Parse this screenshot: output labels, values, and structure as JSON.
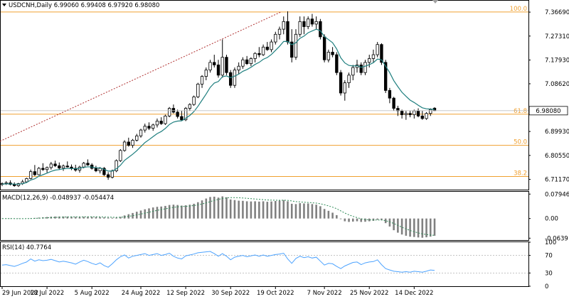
{
  "header": {
    "symbol_line": "USDCNH,Daily  6.99060 6.99408 6.97920 6.98080"
  },
  "colors": {
    "candle": "#000000",
    "ema": "#1f7f7f",
    "fib": "#f0a030",
    "trendline": "#b03030",
    "macd_hist": "#808080",
    "macd_signal": "#2e8b57",
    "rsi": "#4da3ff",
    "price_tag_bg": "#ffffff"
  },
  "chart_data": [
    {
      "type": "candlestick",
      "panel": "price",
      "title": "USDCNH,Daily",
      "ohlc_last": {
        "open": 6.9906,
        "high": 6.99408,
        "low": 6.9792,
        "close": 6.9808
      },
      "last_price_label": "6.98080",
      "ylim": [
        6.6715,
        7.4116
      ],
      "y_ticks": [
        "7.36690",
        "7.27310",
        "7.17930",
        "7.08620",
        "6.99930",
        "6.89930",
        "6.80550",
        "6.71170"
      ],
      "y_tick_values": [
        7.3669,
        7.2731,
        7.1793,
        7.0862,
        6.9993,
        6.8993,
        6.8055,
        6.7117
      ],
      "fib_levels": [
        {
          "label": "100.0",
          "value": 7.3675
        },
        {
          "label": "61.8",
          "value": 6.967
        },
        {
          "label": "50.0",
          "value": 6.845
        },
        {
          "label": "38.2",
          "value": 6.723
        }
      ],
      "trendline": {
        "from": {
          "date": "29 Jun 2022",
          "value": 6.861
        },
        "to": {
          "date": "19 Oct 2022",
          "value": 7.3675
        }
      },
      "x_ticks": [
        "29 Jun 2022",
        "18 Jul 2022",
        "5 Aug 2022",
        "24 Aug 2022",
        "12 Sep 2022",
        "30 Sep 2022",
        "19 Oct 2022",
        "7 Nov 2022",
        "25 Nov 2022",
        "14 Dec 2022"
      ],
      "candles": [
        [
          6.692,
          6.7,
          6.685,
          6.695
        ],
        [
          6.695,
          6.705,
          6.69,
          6.698
        ],
        [
          6.698,
          6.708,
          6.688,
          6.692
        ],
        [
          6.692,
          6.7,
          6.683,
          6.687
        ],
        [
          6.687,
          6.698,
          6.682,
          6.695
        ],
        [
          6.695,
          6.71,
          6.69,
          6.702
        ],
        [
          6.702,
          6.718,
          6.698,
          6.715
        ],
        [
          6.715,
          6.75,
          6.712,
          6.742
        ],
        [
          6.742,
          6.768,
          6.725,
          6.73
        ],
        [
          6.73,
          6.76,
          6.728,
          6.755
        ],
        [
          6.755,
          6.775,
          6.745,
          6.75
        ],
        [
          6.75,
          6.762,
          6.738,
          6.758
        ],
        [
          6.758,
          6.78,
          6.75,
          6.772
        ],
        [
          6.772,
          6.785,
          6.76,
          6.765
        ],
        [
          6.765,
          6.778,
          6.75,
          6.756
        ],
        [
          6.756,
          6.77,
          6.745,
          6.764
        ],
        [
          6.764,
          6.782,
          6.758,
          6.76
        ],
        [
          6.76,
          6.77,
          6.748,
          6.755
        ],
        [
          6.755,
          6.769,
          6.742,
          6.748
        ],
        [
          6.748,
          6.765,
          6.738,
          6.76
        ],
        [
          6.76,
          6.78,
          6.755,
          6.775
        ],
        [
          6.775,
          6.79,
          6.765,
          6.768
        ],
        [
          6.768,
          6.775,
          6.75,
          6.755
        ],
        [
          6.755,
          6.765,
          6.74,
          6.745
        ],
        [
          6.745,
          6.76,
          6.735,
          6.755
        ],
        [
          6.755,
          6.76,
          6.725,
          6.73
        ],
        [
          6.73,
          6.74,
          6.71,
          6.72
        ],
        [
          6.72,
          6.75,
          6.715,
          6.745
        ],
        [
          6.745,
          6.79,
          6.74,
          6.785
        ],
        [
          6.785,
          6.83,
          6.78,
          6.825
        ],
        [
          6.825,
          6.865,
          6.82,
          6.858
        ],
        [
          6.858,
          6.875,
          6.84,
          6.845
        ],
        [
          6.845,
          6.87,
          6.835,
          6.865
        ],
        [
          6.865,
          6.89,
          6.86,
          6.882
        ],
        [
          6.882,
          6.91,
          6.875,
          6.905
        ],
        [
          6.905,
          6.93,
          6.895,
          6.92
        ],
        [
          6.92,
          6.935,
          6.905,
          6.912
        ],
        [
          6.912,
          6.93,
          6.902,
          6.925
        ],
        [
          6.925,
          6.95,
          6.915,
          6.94
        ],
        [
          6.94,
          6.955,
          6.925,
          6.93
        ],
        [
          6.93,
          6.965,
          6.925,
          6.96
        ],
        [
          6.96,
          6.995,
          6.955,
          6.99
        ],
        [
          6.99,
          7.005,
          6.97,
          6.975
        ],
        [
          6.975,
          6.985,
          6.95,
          6.958
        ],
        [
          6.958,
          6.98,
          6.94,
          6.945
        ],
        [
          6.945,
          6.995,
          6.94,
          6.99
        ],
        [
          6.99,
          7.01,
          6.98,
          7.005
        ],
        [
          7.005,
          7.04,
          7.0,
          7.035
        ],
        [
          7.035,
          7.09,
          7.03,
          7.085
        ],
        [
          7.085,
          7.12,
          7.07,
          7.115
        ],
        [
          7.115,
          7.15,
          7.1,
          7.14
        ],
        [
          7.14,
          7.18,
          7.13,
          7.17
        ],
        [
          7.17,
          7.2,
          7.15,
          7.16
        ],
        [
          7.16,
          7.18,
          7.11,
          7.12
        ],
        [
          7.12,
          7.26,
          7.11,
          7.19
        ],
        [
          7.19,
          7.2,
          7.12,
          7.13
        ],
        [
          7.13,
          7.14,
          7.07,
          7.08
        ],
        [
          7.08,
          7.15,
          7.07,
          7.14
        ],
        [
          7.14,
          7.17,
          7.125,
          7.155
        ],
        [
          7.155,
          7.19,
          7.145,
          7.18
        ],
        [
          7.18,
          7.195,
          7.16,
          7.165
        ],
        [
          7.165,
          7.19,
          7.155,
          7.185
        ],
        [
          7.185,
          7.21,
          7.17,
          7.205
        ],
        [
          7.205,
          7.23,
          7.19,
          7.2
        ],
        [
          7.2,
          7.24,
          7.195,
          7.23
        ],
        [
          7.23,
          7.25,
          7.215,
          7.22
        ],
        [
          7.22,
          7.26,
          7.21,
          7.25
        ],
        [
          7.25,
          7.29,
          7.24,
          7.28
        ],
        [
          7.28,
          7.31,
          7.26,
          7.3
        ],
        [
          7.3,
          7.35,
          7.28,
          7.33
        ],
        [
          7.33,
          7.37,
          7.24,
          7.25
        ],
        [
          7.25,
          7.3,
          7.17,
          7.19
        ],
        [
          7.19,
          7.3,
          7.18,
          7.28
        ],
        [
          7.28,
          7.35,
          7.27,
          7.33
        ],
        [
          7.33,
          7.35,
          7.28,
          7.31
        ],
        [
          7.31,
          7.35,
          7.3,
          7.34
        ],
        [
          7.34,
          7.36,
          7.31,
          7.32
        ],
        [
          7.32,
          7.35,
          7.3,
          7.33
        ],
        [
          7.33,
          7.34,
          7.26,
          7.27
        ],
        [
          7.27,
          7.28,
          7.17,
          7.18
        ],
        [
          7.18,
          7.22,
          7.17,
          7.21
        ],
        [
          7.21,
          7.23,
          7.19,
          7.2
        ],
        [
          7.2,
          7.21,
          7.12,
          7.13
        ],
        [
          7.13,
          7.14,
          7.04,
          7.05
        ],
        [
          7.05,
          7.1,
          7.02,
          7.09
        ],
        [
          7.09,
          7.13,
          7.07,
          7.12
        ],
        [
          7.12,
          7.16,
          7.1,
          7.15
        ],
        [
          7.15,
          7.18,
          7.13,
          7.16
        ],
        [
          7.16,
          7.17,
          7.12,
          7.13
        ],
        [
          7.13,
          7.18,
          7.12,
          7.17
        ],
        [
          7.17,
          7.2,
          7.15,
          7.185
        ],
        [
          7.185,
          7.22,
          7.17,
          7.2
        ],
        [
          7.2,
          7.25,
          7.19,
          7.24
        ],
        [
          7.24,
          7.245,
          7.16,
          7.17
        ],
        [
          7.17,
          7.18,
          7.05,
          7.06
        ],
        [
          7.06,
          7.07,
          7.01,
          7.03
        ],
        [
          7.03,
          7.035,
          6.98,
          6.99
        ],
        [
          6.99,
          7.0,
          6.96,
          6.98
        ],
        [
          6.98,
          6.985,
          6.95,
          6.965
        ],
        [
          6.965,
          6.98,
          6.945,
          6.97
        ],
        [
          6.97,
          6.98,
          6.955,
          6.965
        ],
        [
          6.965,
          6.985,
          6.95,
          6.98
        ],
        [
          6.98,
          6.99,
          6.955,
          6.96
        ],
        [
          6.96,
          6.98,
          6.945,
          6.95
        ],
        [
          6.95,
          6.975,
          6.945,
          6.97
        ],
        [
          6.97,
          6.99,
          6.96,
          6.985
        ],
        [
          6.9906,
          6.9941,
          6.9792,
          6.9808
        ]
      ],
      "ema_values": [
        6.693,
        6.694,
        6.694,
        6.693,
        6.693,
        6.695,
        6.699,
        6.709,
        6.714,
        6.724,
        6.73,
        6.736,
        6.743,
        6.748,
        6.75,
        6.753,
        6.754,
        6.754,
        6.753,
        6.755,
        6.759,
        6.761,
        6.76,
        6.757,
        6.757,
        6.751,
        6.744,
        6.744,
        6.753,
        6.767,
        6.786,
        6.798,
        6.81,
        6.824,
        6.84,
        6.856,
        6.867,
        6.879,
        6.891,
        6.899,
        6.911,
        6.927,
        6.936,
        6.94,
        6.941,
        6.951,
        6.962,
        6.977,
        6.998,
        7.022,
        7.046,
        7.072,
        7.089,
        7.095,
        7.114,
        7.117,
        7.11,
        7.116,
        7.124,
        7.135,
        7.142,
        7.151,
        7.162,
        7.17,
        7.182,
        7.189,
        7.201,
        7.217,
        7.233,
        7.252,
        7.252,
        7.239,
        7.247,
        7.264,
        7.273,
        7.286,
        7.293,
        7.3,
        7.294,
        7.271,
        7.259,
        7.247,
        7.223,
        7.188,
        7.168,
        7.158,
        7.156,
        7.157,
        7.151,
        7.155,
        7.161,
        7.169,
        7.183,
        7.18,
        7.155,
        7.13,
        7.099,
        7.075,
        7.053,
        7.037,
        7.022,
        7.013,
        7.002,
        6.992,
        6.988,
        6.987,
        6.986
      ],
      "ema_label": ""
    },
    {
      "type": "bar+line",
      "panel": "macd",
      "title": "MACD(12,26,9) -0.048937 -0.054474",
      "y_ticks": [
        "0.079462",
        "0.00",
        "-0.0639"
      ],
      "y_tick_values": [
        0.079462,
        0.0,
        -0.0639
      ],
      "ylim": [
        -0.07,
        0.087
      ],
      "histogram": [
        -0.001,
        -0.001,
        -0.001,
        -0.001,
        -0.0008,
        -0.0005,
        -0.0003,
        0.001,
        0.002,
        0.003,
        0.004,
        0.005,
        0.006,
        0.0065,
        0.0065,
        0.0065,
        0.0064,
        0.006,
        0.0055,
        0.0055,
        0.0057,
        0.0058,
        0.0055,
        0.005,
        0.0045,
        0.0038,
        0.0028,
        0.0025,
        0.003,
        0.0055,
        0.01,
        0.014,
        0.018,
        0.022,
        0.026,
        0.03,
        0.033,
        0.036,
        0.038,
        0.039,
        0.041,
        0.044,
        0.045,
        0.044,
        0.042,
        0.043,
        0.045,
        0.048,
        0.053,
        0.059,
        0.065,
        0.07,
        0.071,
        0.068,
        0.072,
        0.069,
        0.062,
        0.06,
        0.058,
        0.0575,
        0.056,
        0.0555,
        0.056,
        0.055,
        0.056,
        0.0545,
        0.0555,
        0.057,
        0.058,
        0.06,
        0.056,
        0.048,
        0.047,
        0.05,
        0.049,
        0.049,
        0.047,
        0.045,
        0.04,
        0.031,
        0.025,
        0.019,
        0.011,
        -0.002,
        -0.009,
        -0.011,
        -0.01,
        -0.009,
        -0.011,
        -0.0105,
        -0.009,
        -0.0075,
        -0.004,
        -0.005,
        -0.015,
        -0.026,
        -0.038,
        -0.046,
        -0.052,
        -0.056,
        -0.059,
        -0.06,
        -0.0615,
        -0.0625,
        -0.061,
        -0.059,
        -0.056
      ],
      "signal": [
        0.0,
        0.0,
        -0.0002,
        -0.0003,
        -0.0004,
        -0.0004,
        -0.0003,
        0.0,
        0.0005,
        0.001,
        0.0016,
        0.0023,
        0.003,
        0.0037,
        0.0042,
        0.0047,
        0.005,
        0.0052,
        0.0053,
        0.0053,
        0.0054,
        0.0055,
        0.0055,
        0.0054,
        0.0052,
        0.0049,
        0.0045,
        0.0041,
        0.0039,
        0.0042,
        0.0053,
        0.007,
        0.0092,
        0.0117,
        0.0145,
        0.0175,
        0.0205,
        0.0235,
        0.0265,
        0.029,
        0.0315,
        0.034,
        0.0362,
        0.0378,
        0.0387,
        0.0396,
        0.0407,
        0.0421,
        0.0442,
        0.0472,
        0.0508,
        0.055,
        0.059,
        0.062,
        0.065,
        0.067,
        0.068,
        0.068,
        0.0676,
        0.0667,
        0.0658,
        0.0646,
        0.0635,
        0.0625,
        0.0613,
        0.0605,
        0.0598,
        0.0595,
        0.0593,
        0.0595,
        0.059,
        0.0572,
        0.055,
        0.054,
        0.053,
        0.0522,
        0.0512,
        0.05,
        0.048,
        0.045,
        0.041,
        0.037,
        0.032,
        0.025,
        0.018,
        0.012,
        0.007,
        0.003,
        -0.001,
        -0.003,
        -0.0045,
        -0.005,
        -0.0048,
        -0.0049,
        -0.0069,
        -0.0107,
        -0.0162,
        -0.0222,
        -0.0282,
        -0.0338,
        -0.0388,
        -0.043,
        -0.0467,
        -0.0499,
        -0.0521,
        -0.0535,
        -0.0545
      ]
    },
    {
      "type": "line",
      "panel": "rsi",
      "title": "RSI(14) 40.7764",
      "y_ticks": [
        "100",
        "70",
        "30",
        "0"
      ],
      "y_tick_values": [
        100,
        70,
        30,
        0
      ],
      "levels": [
        70,
        30
      ],
      "ylim": [
        0,
        100
      ],
      "values": [
        48,
        49,
        47,
        45,
        48,
        52,
        55,
        62,
        57,
        60,
        58,
        59,
        61,
        58,
        55,
        57,
        55,
        53,
        50,
        55,
        59,
        56,
        52,
        49,
        53,
        47,
        43,
        51,
        60,
        67,
        71,
        64,
        68,
        70,
        72,
        74,
        70,
        72,
        74,
        70,
        72,
        75,
        68,
        64,
        62,
        69,
        71,
        73,
        76,
        77,
        78,
        79,
        74,
        68,
        74,
        68,
        60,
        66,
        68,
        70,
        67,
        69,
        71,
        68,
        71,
        68,
        70,
        72,
        73,
        75,
        62,
        52,
        63,
        68,
        65,
        67,
        64,
        66,
        57,
        48,
        52,
        51,
        45,
        40,
        46,
        50,
        54,
        55,
        49,
        53,
        55,
        56,
        60,
        49,
        40,
        37,
        34,
        33,
        32,
        33,
        32,
        34,
        33,
        32,
        34,
        37,
        36
      ]
    }
  ]
}
